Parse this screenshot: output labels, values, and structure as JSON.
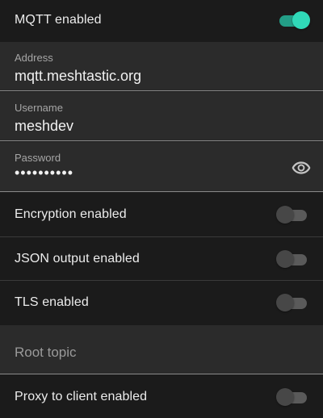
{
  "mqtt": {
    "enabled_label": "MQTT enabled",
    "enabled": true
  },
  "address": {
    "label": "Address",
    "value": "mqtt.meshtastic.org"
  },
  "username": {
    "label": "Username",
    "value": "meshdev"
  },
  "password": {
    "label": "Password",
    "value": "••••••••••",
    "icon": "eye-icon"
  },
  "encryption": {
    "label": "Encryption enabled",
    "enabled": false
  },
  "json_output": {
    "label": "JSON output enabled",
    "enabled": false
  },
  "tls": {
    "label": "TLS enabled",
    "enabled": false
  },
  "root_topic": {
    "placeholder": "Root topic"
  },
  "proxy": {
    "label": "Proxy to client enabled",
    "enabled": false
  },
  "colors": {
    "background": "#1b1b1b",
    "field_background": "#2b2b2b",
    "accent": "#30d9b8"
  }
}
